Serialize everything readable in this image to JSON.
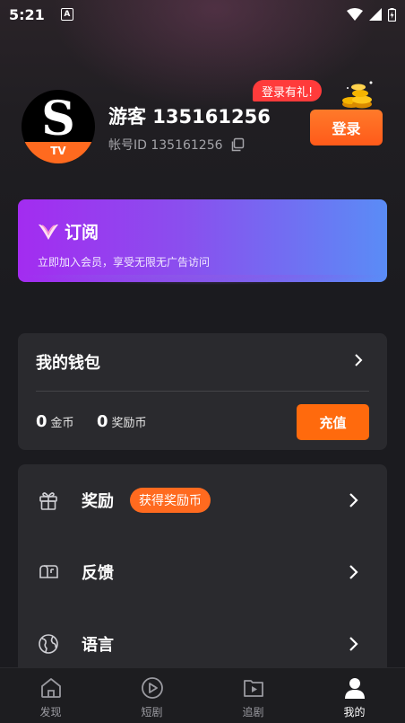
{
  "status_bar": {
    "time": "5:21",
    "notif_icon": "A"
  },
  "profile": {
    "avatar_letter": "S",
    "avatar_badge": "TV",
    "username": "游客 135161256",
    "account_id": "帐号ID 135161256",
    "promo_bubble": "登录有礼!",
    "login_label": "登录"
  },
  "subscription": {
    "title": "订阅",
    "description": "立即加入会员，享受无限无广告访问"
  },
  "wallet": {
    "title": "我的钱包",
    "coins_value": "0",
    "coins_label": "金币",
    "reward_value": "0",
    "reward_label": "奖励币",
    "recharge_label": "充值"
  },
  "menu": [
    {
      "label": "奖励",
      "badge": "获得奖励币",
      "icon": "gift-icon"
    },
    {
      "label": "反馈",
      "badge": "",
      "icon": "mailbox-icon"
    },
    {
      "label": "语言",
      "badge": "",
      "icon": "globe-icon"
    }
  ],
  "nav": [
    {
      "label": "发现",
      "icon": "home-icon"
    },
    {
      "label": "短剧",
      "icon": "play-circle-icon"
    },
    {
      "label": "追剧",
      "icon": "folder-play-icon"
    },
    {
      "label": "我的",
      "icon": "user-icon",
      "active": true
    }
  ],
  "colors": {
    "accent": "#ff6a1f",
    "background": "#1b1b1f",
    "card": "#2a2a2e"
  }
}
